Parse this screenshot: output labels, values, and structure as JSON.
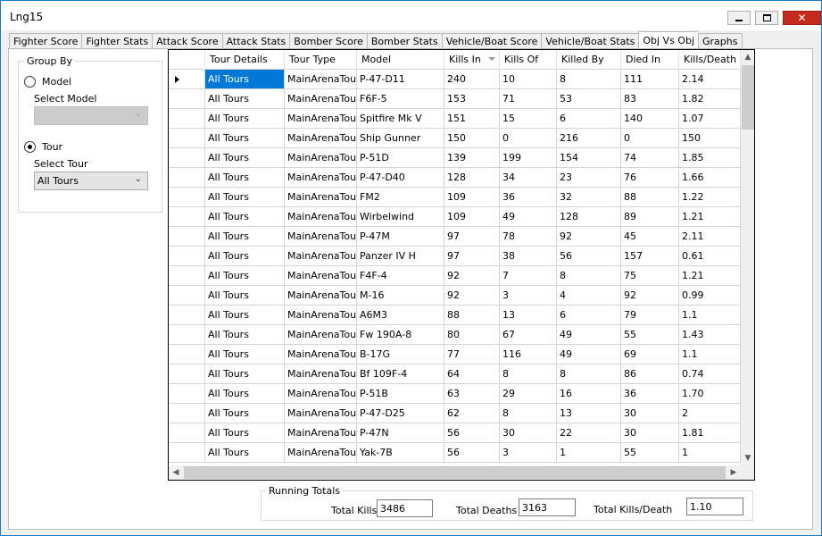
{
  "window": {
    "title": "Lng15",
    "minimize_icon": "minimize-icon",
    "maximize_icon": "maximize-icon",
    "close_icon": "close-icon",
    "close_glyph": "✕"
  },
  "tabs": [
    {
      "label": "Fighter Score"
    },
    {
      "label": "Fighter Stats"
    },
    {
      "label": "Attack Score"
    },
    {
      "label": "Attack Stats"
    },
    {
      "label": "Bomber Score"
    },
    {
      "label": "Bomber Stats"
    },
    {
      "label": "Vehicle/Boat Score"
    },
    {
      "label": "Vehicle/Boat Stats"
    },
    {
      "label": "Obj Vs Obj",
      "active": true
    },
    {
      "label": "Graphs"
    }
  ],
  "group_by": {
    "legend": "Group By",
    "model_radio": "Model",
    "select_model_label": "Select Model",
    "select_model_value": "",
    "tour_radio": "Tour",
    "select_tour_label": "Select Tour",
    "select_tour_value": "All Tours",
    "selected": "Tour"
  },
  "grid": {
    "columns": [
      "Tour Details",
      "Tour Type",
      "Model",
      "Kills In",
      "Kills Of",
      "Killed By",
      "Died In",
      "Kills/Death"
    ],
    "sorted_column": "Kills In",
    "sort_direction": "descending",
    "selected_row": 0,
    "rows": [
      [
        "All Tours",
        "MainArenaTour",
        "P-47-D11",
        "240",
        "10",
        "8",
        "111",
        "2.14"
      ],
      [
        "All Tours",
        "MainArenaTour",
        "F6F-5",
        "153",
        "71",
        "53",
        "83",
        "1.82"
      ],
      [
        "All Tours",
        "MainArenaTour",
        "Spitfire Mk V",
        "151",
        "15",
        "6",
        "140",
        "1.07"
      ],
      [
        "All Tours",
        "MainArenaTour",
        "Ship Gunner",
        "150",
        "0",
        "216",
        "0",
        "150"
      ],
      [
        "All Tours",
        "MainArenaTour",
        "P-51D",
        "139",
        "199",
        "154",
        "74",
        "1.85"
      ],
      [
        "All Tours",
        "MainArenaTour",
        "P-47-D40",
        "128",
        "34",
        "23",
        "76",
        "1.66"
      ],
      [
        "All Tours",
        "MainArenaTour",
        "FM2",
        "109",
        "36",
        "32",
        "88",
        "1.22"
      ],
      [
        "All Tours",
        "MainArenaTour",
        "Wirbelwind",
        "109",
        "49",
        "128",
        "89",
        "1.21"
      ],
      [
        "All Tours",
        "MainArenaTour",
        "P-47M",
        "97",
        "78",
        "92",
        "45",
        "2.11"
      ],
      [
        "All Tours",
        "MainArenaTour",
        "Panzer IV H",
        "97",
        "38",
        "56",
        "157",
        "0.61"
      ],
      [
        "All Tours",
        "MainArenaTour",
        "F4F-4",
        "92",
        "7",
        "8",
        "75",
        "1.21"
      ],
      [
        "All Tours",
        "MainArenaTour",
        "M-16",
        "92",
        "3",
        "4",
        "92",
        "0.99"
      ],
      [
        "All Tours",
        "MainArenaTour",
        "A6M3",
        "88",
        "13",
        "6",
        "79",
        "1.1"
      ],
      [
        "All Tours",
        "MainArenaTour",
        "Fw 190A-8",
        "80",
        "67",
        "49",
        "55",
        "1.43"
      ],
      [
        "All Tours",
        "MainArenaTour",
        "B-17G",
        "77",
        "116",
        "49",
        "69",
        "1.1"
      ],
      [
        "All Tours",
        "MainArenaTour",
        "Bf 109F-4",
        "64",
        "8",
        "8",
        "86",
        "0.74"
      ],
      [
        "All Tours",
        "MainArenaTour",
        "P-51B",
        "63",
        "29",
        "16",
        "36",
        "1.70"
      ],
      [
        "All Tours",
        "MainArenaTour",
        "P-47-D25",
        "62",
        "8",
        "13",
        "30",
        "2"
      ],
      [
        "All Tours",
        "MainArenaTour",
        "P-47N",
        "56",
        "30",
        "22",
        "30",
        "1.81"
      ],
      [
        "All Tours",
        "MainArenaTour",
        "Yak-7B",
        "56",
        "3",
        "1",
        "55",
        "1"
      ]
    ],
    "scroll_up_icon": "scroll-up-icon",
    "scroll_down_icon": "scroll-down-icon",
    "scroll_left_icon": "scroll-left-icon",
    "scroll_right_icon": "scroll-right-icon"
  },
  "totals": {
    "legend": "Running Totals",
    "total_kills_label": "Total Kills",
    "total_kills": "3486",
    "total_deaths_label": "Total Deaths",
    "total_deaths": "3163",
    "total_kd_label": "Total Kills/Death",
    "total_kd": "1.10"
  },
  "colors": {
    "selection": "#0078d7",
    "window_border": "#1979ca",
    "close_button": "#c42b1c"
  }
}
